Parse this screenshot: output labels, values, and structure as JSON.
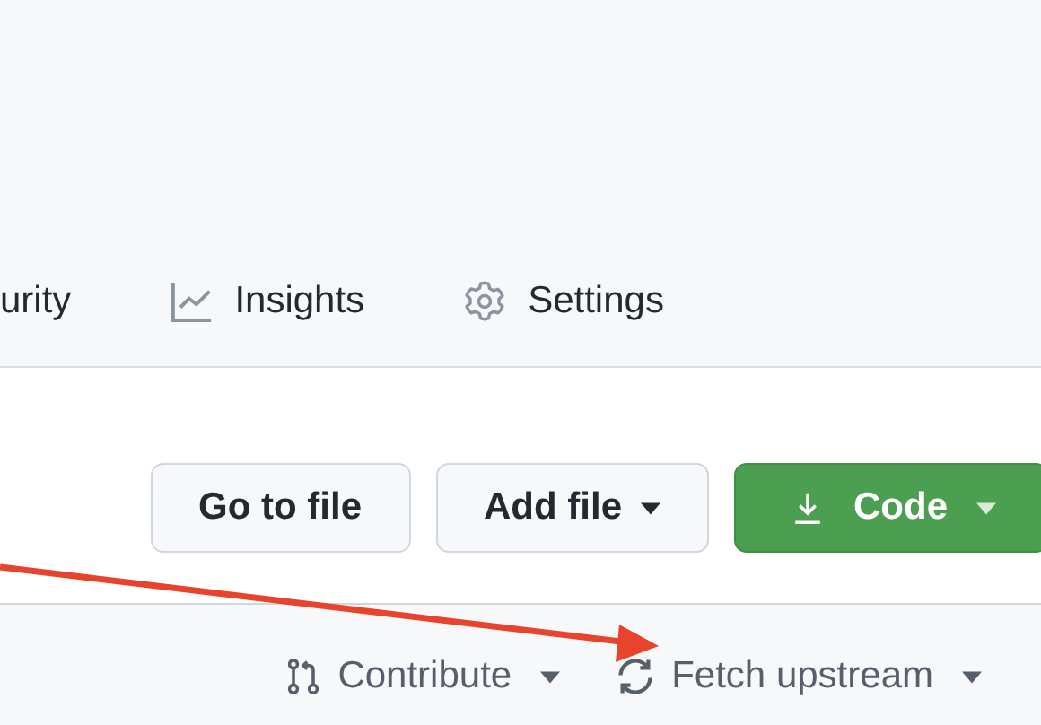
{
  "tabs": [
    {
      "label": "urity"
    },
    {
      "label": "Insights"
    },
    {
      "label": "Settings"
    }
  ],
  "toolbar": [
    {
      "label": "Go to file",
      "kind": "default",
      "dropdown": false
    },
    {
      "label": "Add file",
      "kind": "default",
      "dropdown": true
    },
    {
      "label": "Code",
      "kind": "primary",
      "dropdown": true
    }
  ],
  "branch_bar": [
    {
      "label": "Contribute",
      "dropdown": true
    },
    {
      "label": "Fetch upstream",
      "dropdown": true
    }
  ]
}
